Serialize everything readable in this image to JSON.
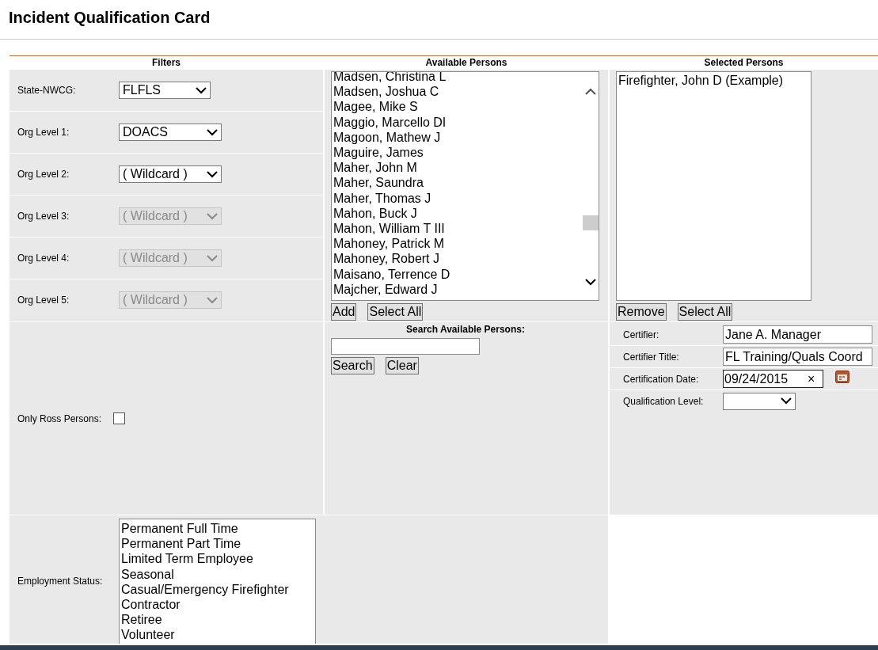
{
  "page": {
    "title": "Incident Qualification Card"
  },
  "headers": [
    "Filters",
    "Available Persons",
    "Selected Persons"
  ],
  "filters": [
    {
      "label": "State-NWCG:",
      "value": "FLFLS",
      "disabled": false
    },
    {
      "label": "Org Level 1:",
      "value": "DOACS",
      "disabled": false
    },
    {
      "label": "Org Level 2:",
      "value": "( Wildcard )",
      "disabled": false
    },
    {
      "label": "Org Level 3:",
      "value": "( Wildcard )",
      "disabled": true
    },
    {
      "label": "Org Level 4:",
      "value": "( Wildcard )",
      "disabled": true
    },
    {
      "label": "Org Level 5:",
      "value": "( Wildcard )",
      "disabled": true
    }
  ],
  "available_persons": {
    "items": [
      "Madsen, Christina L",
      "Madsen, Joshua C",
      "Magee, Mike S",
      "Maggio, Marcello DI",
      "Magoon, Mathew J",
      "Maguire, James",
      "Maher, John M",
      "Maher, Saundra",
      "Maher, Thomas J",
      "Mahon, Buck J",
      "Mahon, William T III",
      "Mahoney, Patrick M",
      "Mahoney, Robert J",
      "Maisano, Terrence D",
      "Majcher, Edward J"
    ],
    "buttons": [
      "Add",
      "Select All"
    ]
  },
  "selected_persons": {
    "items": [
      "Firefighter, John D (Example)"
    ],
    "buttons": [
      "Remove",
      "Select All"
    ]
  },
  "search": {
    "label": "Search Available Persons:",
    "buttons": [
      "Search",
      "Clear"
    ]
  },
  "only_ross": {
    "label": "Only Ross Persons:",
    "checked": false
  },
  "certification": [
    {
      "kind": "text",
      "label": "Certifier:",
      "value": "Jane A. Manager"
    },
    {
      "kind": "text",
      "label": "Certifier Title:",
      "value": "FL Training/Quals Coord"
    },
    {
      "kind": "date",
      "label": "Certification Date:",
      "value": "09/24/2015",
      "clear": "×"
    },
    {
      "kind": "select",
      "label": "Qualification Level:"
    }
  ],
  "employment_status": {
    "label": "Employment Status:",
    "items": [
      "Permanent Full Time",
      "Permanent Part Time",
      "Limited Term Employee",
      "Seasonal",
      "Casual/Emergency Firefighter",
      "Contractor",
      "Retiree",
      "Volunteer"
    ]
  }
}
